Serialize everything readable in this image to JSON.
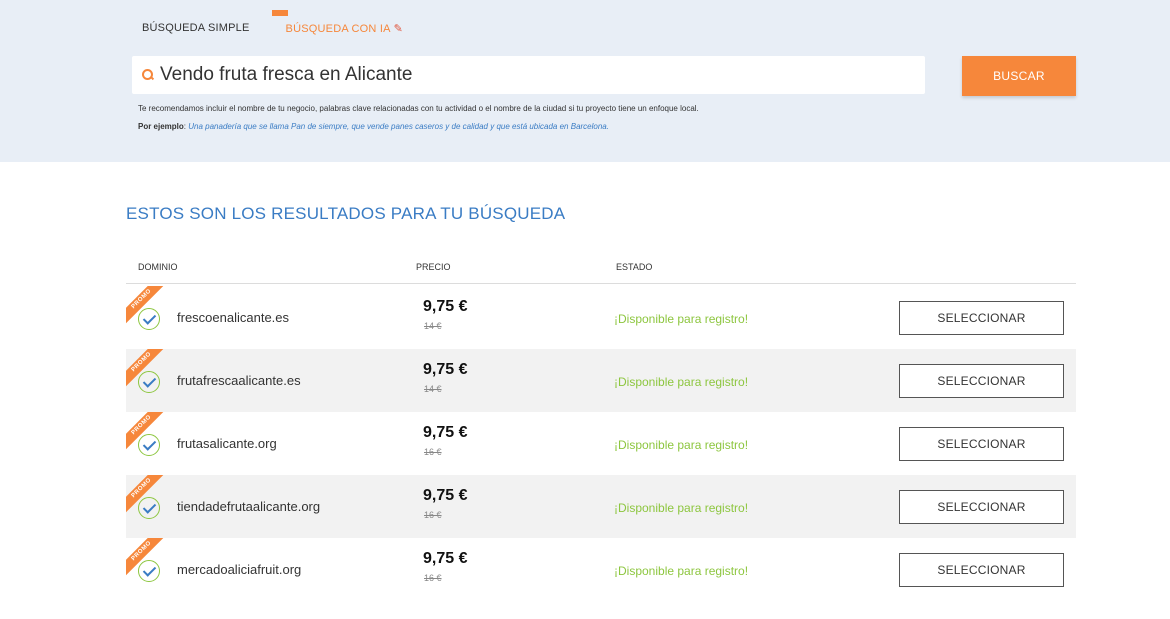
{
  "tabs": {
    "simple": "BÚSQUEDA SIMPLE",
    "ia": "BÚSQUEDA CON IA"
  },
  "search": {
    "value": "Vendo fruta fresca en Alicante",
    "button": "BUSCAR"
  },
  "hint": "Te recomendamos incluir el nombre de tu negocio, palabras clave relacionadas con tu actividad o el nombre de la ciudad si tu proyecto tiene un enfoque local.",
  "example": {
    "label": "Por ejemplo",
    "text": "Una panadería que se llama Pan de siempre, que vende panes caseros y de calidad y que está ubicada en Barcelona."
  },
  "results": {
    "title": "ESTOS SON LOS RESULTADOS PARA TU BÚSQUEDA",
    "headers": {
      "domain": "DOMINIO",
      "price": "PRECIO",
      "state": "ESTADO"
    },
    "rows": [
      {
        "promo": "PROMO",
        "domain": "frescoenalicante.es",
        "price": "9,75 €",
        "old_price": "14 €",
        "state": "¡Disponible para registro!",
        "button": "SELECCIONAR"
      },
      {
        "promo": "PROMO",
        "domain": "frutafrescaalicante.es",
        "price": "9,75 €",
        "old_price": "14 €",
        "state": "¡Disponible para registro!",
        "button": "SELECCIONAR"
      },
      {
        "promo": "PROMO",
        "domain": "frutasalicante.org",
        "price": "9,75 €",
        "old_price": "16 €",
        "state": "¡Disponible para registro!",
        "button": "SELECCIONAR"
      },
      {
        "promo": "PROMO",
        "domain": "tiendadefrutaalicante.org",
        "price": "9,75 €",
        "old_price": "16 €",
        "state": "¡Disponible para registro!",
        "button": "SELECCIONAR"
      },
      {
        "promo": "PROMO",
        "domain": "mercadoaliciafruit.org",
        "price": "9,75 €",
        "old_price": "16 €",
        "state": "¡Disponible para registro!",
        "button": "SELECCIONAR"
      }
    ]
  },
  "colors": {
    "accent": "#f6873b",
    "link": "#3a7cc4",
    "available": "#8dc63f",
    "header_bg": "#e8eef6"
  }
}
